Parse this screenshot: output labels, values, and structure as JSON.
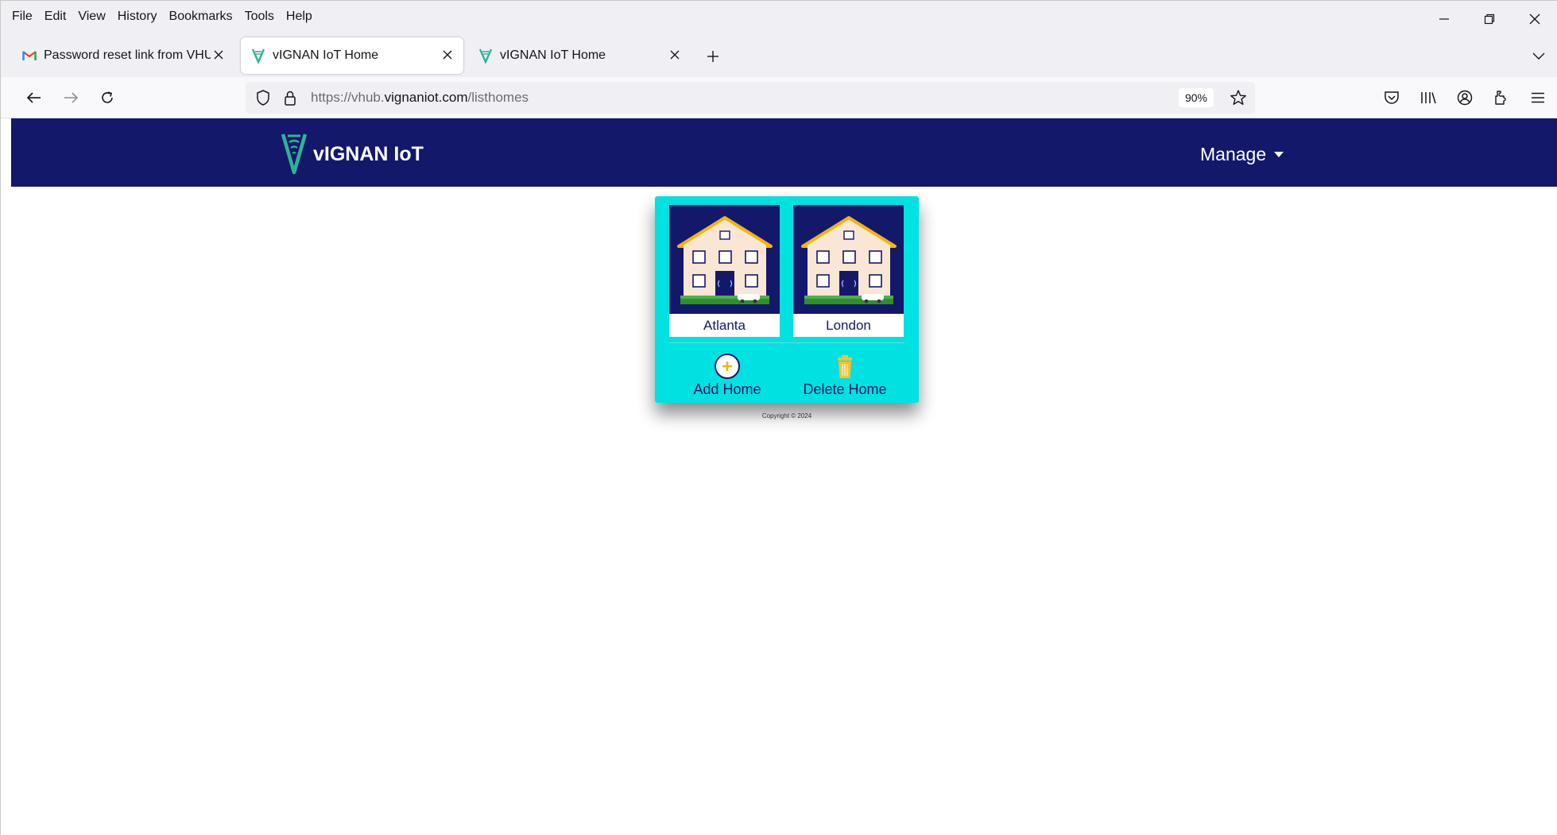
{
  "browser": {
    "menu": [
      "File",
      "Edit",
      "View",
      "History",
      "Bookmarks",
      "Tools",
      "Help"
    ],
    "tabs": [
      {
        "label": "Password reset link from VHUB.VIGNANIOT.COM",
        "icon": "gmail-icon",
        "active": false
      },
      {
        "label": "vIGNAN IoT Home",
        "icon": "vignan-icon",
        "active": true
      },
      {
        "label": "vIGNAN IoT Home",
        "icon": "vignan-icon",
        "active": false
      }
    ],
    "url": {
      "prefix": "https://vhub.",
      "host": "vignaniot.com",
      "path": "/listhomes"
    },
    "zoom": "90%"
  },
  "site": {
    "brand": "vIGNAN IoT",
    "manage_label": "Manage",
    "homes": [
      {
        "name": "Atlanta"
      },
      {
        "name": "London"
      }
    ],
    "actions": {
      "add_label": "Add Home",
      "delete_label": "Delete Home"
    },
    "copyright": "Copyright © 2024"
  },
  "colors": {
    "header_bg": "#14186a",
    "panel_bg": "#00e1e1",
    "accent_yellow": "#f5b50a"
  }
}
